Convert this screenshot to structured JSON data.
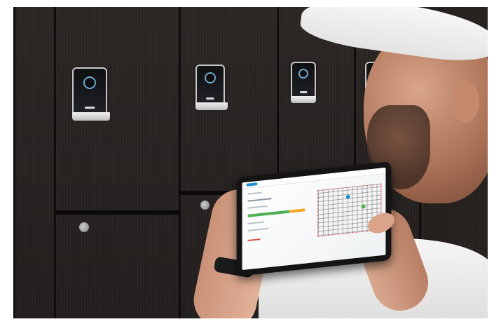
{
  "scene": {
    "description_tags": [
      "locker-wall",
      "electronic-locks",
      "tablet",
      "person-white-cap"
    ],
    "colors": {
      "wood": "#2a2523",
      "lock_ring": "#6fa9c9",
      "screen_accent": "#1f8fd1",
      "progress_green": "#4caf50",
      "progress_orange": "#f5a623",
      "alert_red": "#e04b4b"
    }
  }
}
